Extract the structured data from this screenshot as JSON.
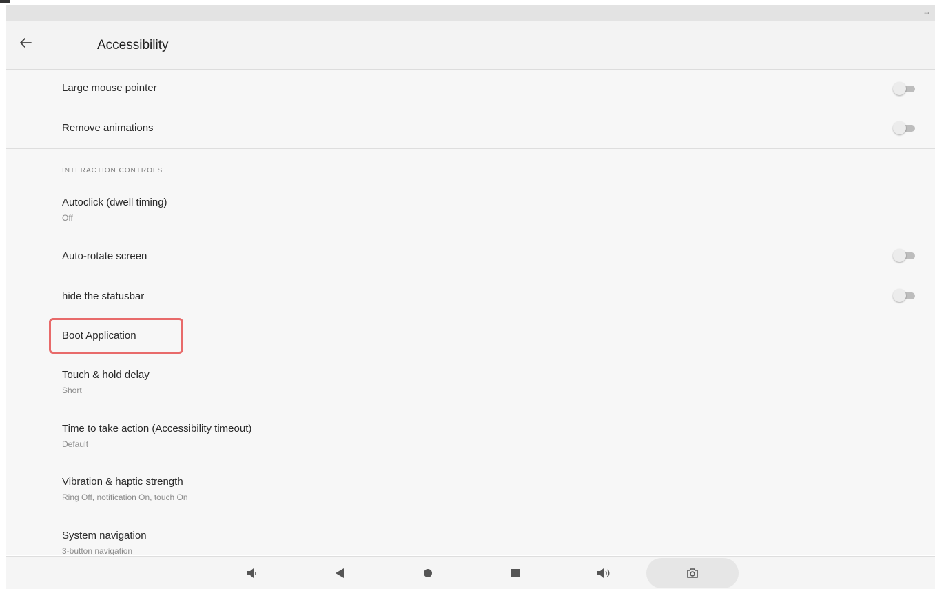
{
  "header": {
    "title": "Accessibility"
  },
  "settings_top": [
    {
      "label": "Large mouse pointer"
    },
    {
      "label": "Remove animations"
    }
  ],
  "section": {
    "label": "INTERACTION CONTROLS"
  },
  "items": [
    {
      "label": "Autoclick (dwell timing)",
      "sub": "Off"
    },
    {
      "label": "Auto-rotate screen"
    },
    {
      "label": "hide the statusbar"
    },
    {
      "label": "Boot Application"
    },
    {
      "label": "Touch & hold delay",
      "sub": "Short"
    },
    {
      "label": "Time to take action (Accessibility timeout)",
      "sub": "Default"
    },
    {
      "label": "Vibration & haptic strength",
      "sub": "Ring Off, notification On, touch On"
    },
    {
      "label": "System navigation",
      "sub": "3-button navigation"
    }
  ],
  "toggles": {
    "large_mouse_pointer": false,
    "remove_animations": false,
    "auto_rotate_screen": false,
    "hide_statusbar": false
  },
  "icons": {
    "back": "arrow-left-icon",
    "expand": "expand-horizontal-icon",
    "nav": [
      "volume-down-icon",
      "back-triangle-icon",
      "home-circle-icon",
      "recents-square-icon",
      "volume-up-icon",
      "camera-icon"
    ]
  },
  "colors": {
    "highlight": "#e86a6a",
    "background": "#f7f7f7",
    "appbar": "#f3f3f3"
  }
}
